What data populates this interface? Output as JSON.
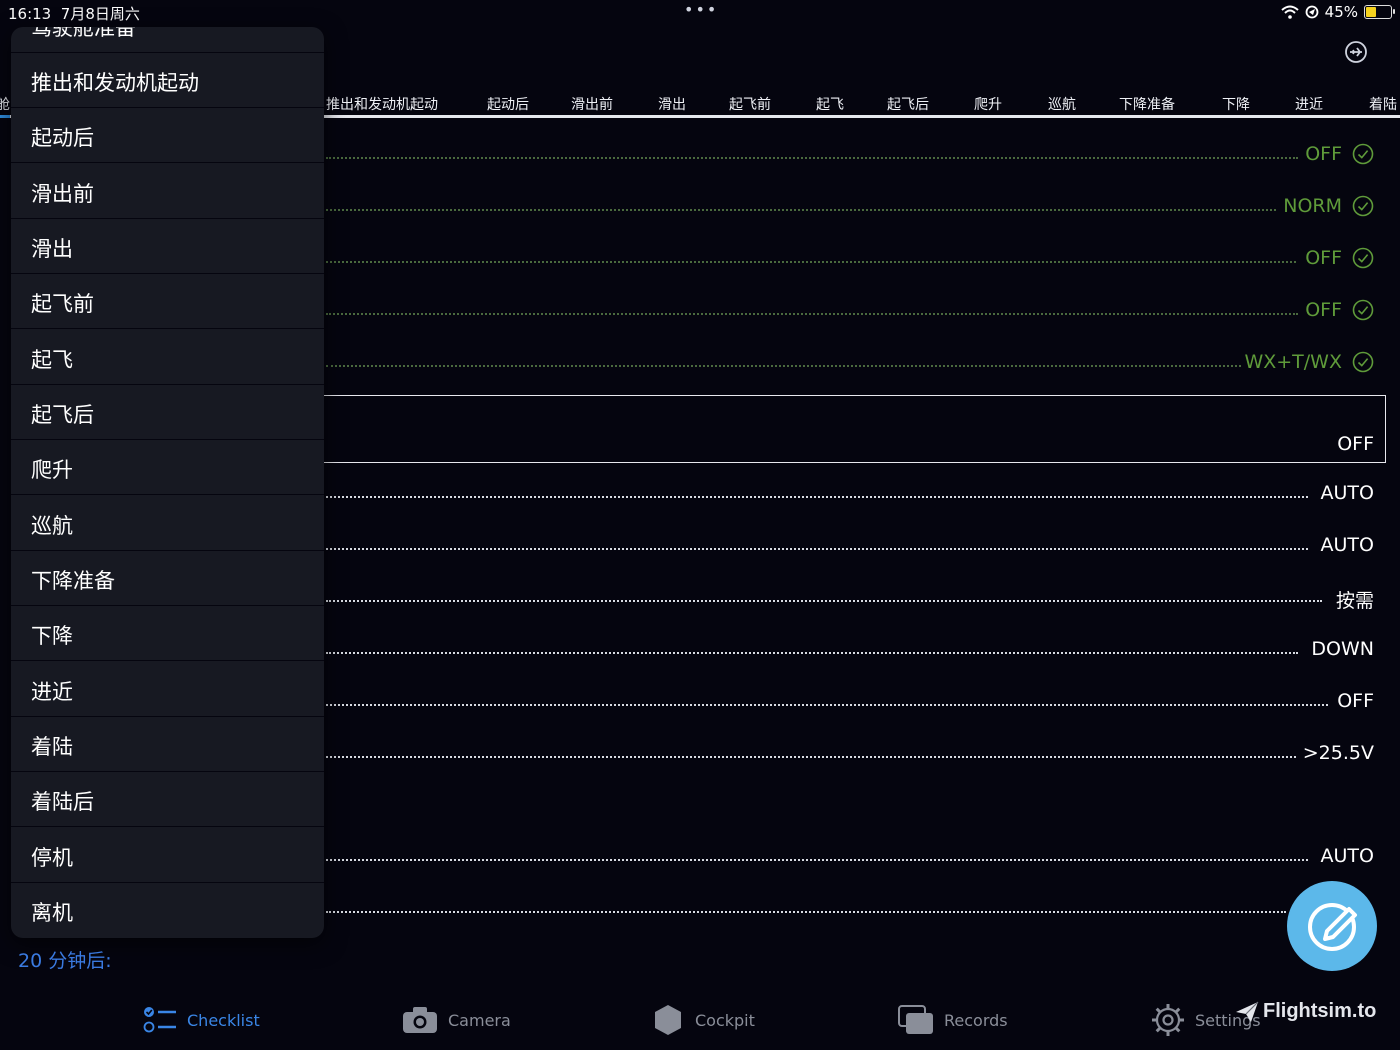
{
  "status_bar": {
    "time": "16:13",
    "date": "7月8日周六",
    "battery": "45%",
    "battery_level": 0.45
  },
  "tabs": [
    {
      "label": "舱"
    },
    {
      "label": "推出和发动机起动"
    },
    {
      "label": "起动后"
    },
    {
      "label": "滑出前"
    },
    {
      "label": "滑出"
    },
    {
      "label": "起飞前"
    },
    {
      "label": "起飞"
    },
    {
      "label": "起飞后"
    },
    {
      "label": "爬升"
    },
    {
      "label": "巡航"
    },
    {
      "label": "下降准备"
    },
    {
      "label": "下降"
    },
    {
      "label": "进近"
    },
    {
      "label": "着陆"
    }
  ],
  "checklist_rows": [
    {
      "value": "OFF",
      "done": true
    },
    {
      "value": "NORM",
      "done": true
    },
    {
      "value": "OFF",
      "done": true
    },
    {
      "value": "OFF",
      "done": true
    },
    {
      "value": "WX+T/WX",
      "done": true
    },
    {
      "value": "AUTO",
      "done": false
    },
    {
      "value": "AUTO",
      "done": false
    },
    {
      "value": "按需",
      "done": false
    },
    {
      "value": "DOWN",
      "done": false
    },
    {
      "value": "OFF",
      "done": false
    },
    {
      "value": ">25.5V",
      "done": false
    },
    {
      "value": "AUTO",
      "done": false
    },
    {
      "value": "",
      "done": false
    }
  ],
  "current_item": {
    "value": "OFF"
  },
  "menu": {
    "header_partial": "驾驶舱准备",
    "items": [
      {
        "label": "推出和发动机起动"
      },
      {
        "label": "起动后"
      },
      {
        "label": "滑出前"
      },
      {
        "label": "滑出"
      },
      {
        "label": "起飞前"
      },
      {
        "label": "起飞"
      },
      {
        "label": "起飞后"
      },
      {
        "label": "爬升"
      },
      {
        "label": "巡航"
      },
      {
        "label": "下降准备"
      },
      {
        "label": "下降"
      },
      {
        "label": "进近"
      },
      {
        "label": "着陆"
      },
      {
        "label": "着陆后"
      },
      {
        "label": "停机"
      },
      {
        "label": "离机"
      }
    ]
  },
  "timer_label": "20 分钟后:",
  "bottom_tabs": [
    {
      "label": "Checklist",
      "icon": "checklist-icon",
      "active": true
    },
    {
      "label": "Camera",
      "icon": "camera-icon",
      "active": false
    },
    {
      "label": "Cockpit",
      "icon": "cockpit-icon",
      "active": false
    },
    {
      "label": "Records",
      "icon": "records-icon",
      "active": false
    },
    {
      "label": "Settings",
      "icon": "gear-icon",
      "active": false
    }
  ],
  "watermark": "Flightsim.to",
  "colors": {
    "done": "#5f9b3a",
    "accent": "#3a86e6",
    "fab": "#5cb8ea",
    "background": "#05050f",
    "menu": "#171922"
  }
}
